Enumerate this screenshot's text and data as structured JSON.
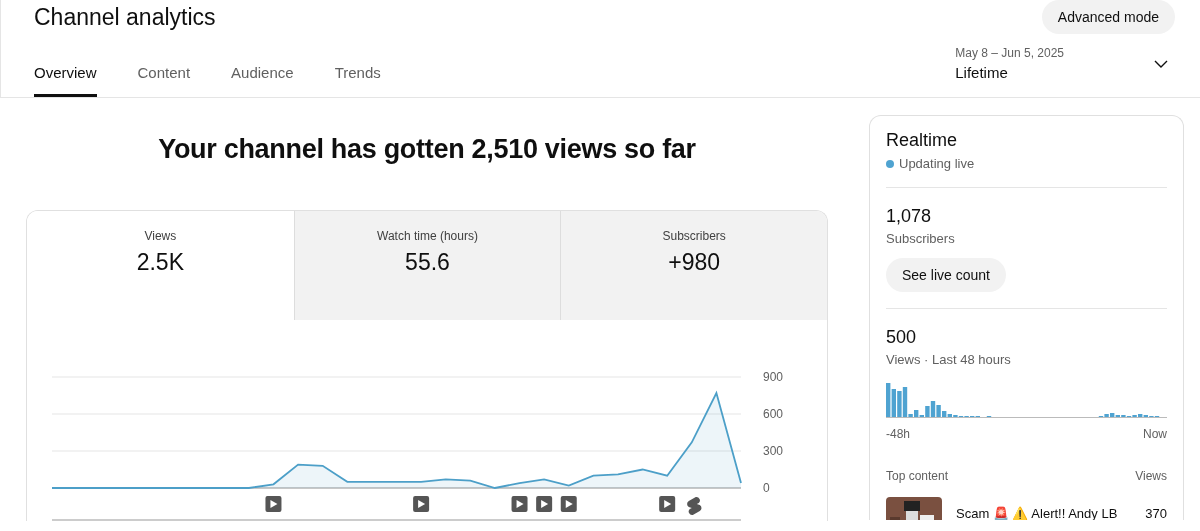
{
  "header": {
    "title": "Channel analytics",
    "advanced_button": "Advanced mode"
  },
  "tabs": [
    {
      "label": "Overview",
      "selected": true
    },
    {
      "label": "Content",
      "selected": false
    },
    {
      "label": "Audience",
      "selected": false
    },
    {
      "label": "Trends",
      "selected": false
    }
  ],
  "date_range": {
    "range": "May 8 – Jun 5, 2025",
    "period": "Lifetime"
  },
  "headline": "Your channel has gotten 2,510 views so far",
  "metrics": [
    {
      "label": "Views",
      "value": "2.5K",
      "selected": true
    },
    {
      "label": "Watch time (hours)",
      "value": "55.6",
      "selected": false
    },
    {
      "label": "Subscribers",
      "value": "+980",
      "selected": false
    }
  ],
  "chart": {
    "chart_data": {
      "type": "area",
      "ylim": [
        0,
        900
      ],
      "yticks": [
        0,
        300,
        600,
        900
      ],
      "series": [
        {
          "color": "#4c9fc8",
          "values": [
            0,
            0,
            0,
            0,
            0,
            0,
            0,
            0,
            0,
            30,
            190,
            180,
            50,
            50,
            50,
            50,
            70,
            60,
            0,
            40,
            70,
            20,
            100,
            110,
            150,
            100,
            370,
            770,
            40
          ]
        }
      ]
    },
    "markers": [
      {
        "kind": "video"
      },
      {
        "kind": "video"
      },
      {
        "kind": "video"
      },
      {
        "kind": "video"
      },
      {
        "kind": "video"
      },
      {
        "kind": "video"
      },
      {
        "kind": "short"
      }
    ]
  },
  "realtime": {
    "title": "Realtime",
    "status": "Updating live",
    "subscribers": "1,078",
    "subscribers_label": "Subscribers",
    "live_button": "See live count",
    "views": "500",
    "views_label": "Views · Last 48 hours",
    "axis_start": "-48h",
    "axis_end": "Now",
    "top_content_label": "Top content",
    "views_column": "Views",
    "top_items": [
      {
        "title": "Scam 🚨 ⚠️ Alert!! Andy LB",
        "views": "370"
      }
    ]
  }
}
